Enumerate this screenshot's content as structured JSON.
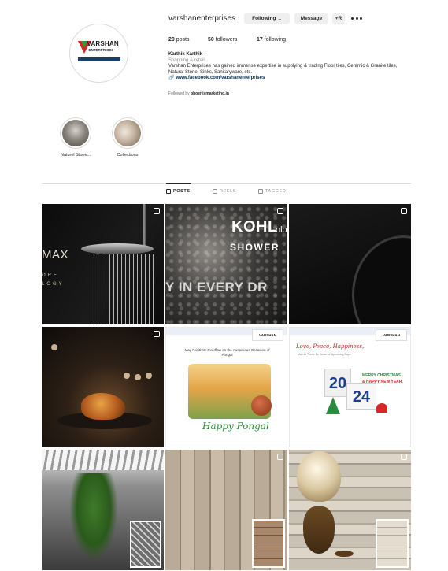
{
  "profile": {
    "username": "varshanenterprises",
    "buttons": {
      "following": "Following",
      "message": "Message",
      "suggest": "+R"
    },
    "avatar": {
      "brand": "VARSHAN",
      "brand_sub": "ENTERPRISES"
    },
    "stats": {
      "posts_count": "20",
      "posts_label": "posts",
      "followers_count": "50",
      "followers_label": "followers",
      "following_count": "17",
      "following_label": "following"
    },
    "bio": {
      "name": "Karthik Karthik",
      "category": "Shopping & retail",
      "text": "Varshan Enterprises has gained immense expertise in supplying & trading Floor tiles, Ceramic & Granite tiles, Natural Stone, Sinks, Sanitaryware, etc.",
      "link": "www.facebook.com/varshanenterprises",
      "followed_by_prefix": "Followed by",
      "followed_by_name": "phoenixmarketing.in"
    }
  },
  "highlights": [
    {
      "label": "Naturel Stone..."
    },
    {
      "label": "Collections"
    }
  ],
  "tabs": [
    {
      "label": "POSTS",
      "active": true
    },
    {
      "label": "REELS",
      "active": false
    },
    {
      "label": "TAGGED",
      "active": false
    }
  ],
  "posts": {
    "p1": {
      "big": "MAX",
      "line1": "ORE",
      "line2": "LOGY"
    },
    "p2": {
      "brand": "KOHL",
      "brand_tail": "ology",
      "sub": "SHOWER",
      "tagline": "Y IN EVERY DR"
    },
    "p5": {
      "wish": "May Positivity Overflow on the Auspicious Occasion of Pongal",
      "greeting": "Happy Pongal",
      "logo": "VARSHAN"
    },
    "p6": {
      "love": "Love, Peace, Happiness,",
      "may": "May all These Be Yours for Upcoming Days",
      "merry": "MERRY CHRISTMAS",
      "hny": "& HAPPY NEW YEAR.",
      "year_a": "20",
      "year_b": "24",
      "logo": "VARSHAN"
    }
  },
  "colors": {
    "link": "#00376b",
    "text": "#262626",
    "muted": "#8e8e8e",
    "button_bg": "#efefef"
  }
}
